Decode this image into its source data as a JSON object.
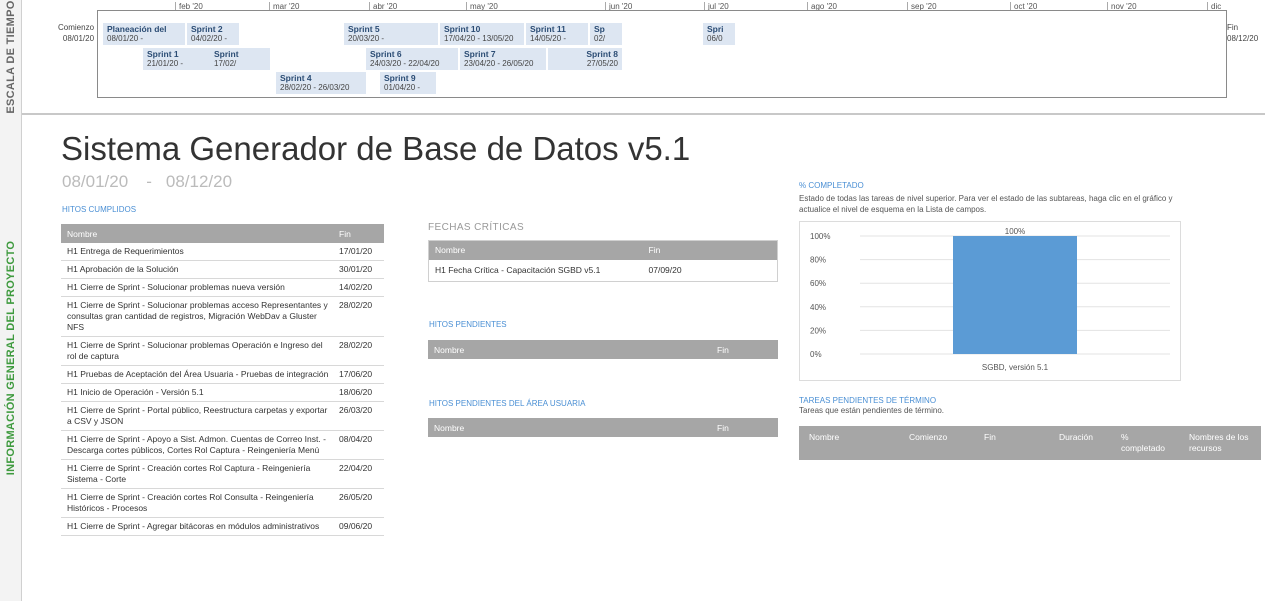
{
  "side": {
    "timeline_label": "ESCALA DE TIEMPO",
    "info_label": "INFORMACIÓN GENERAL DEL PROYECTO"
  },
  "timeline": {
    "start_label": "Comienzo",
    "start_date": "08/01/20",
    "end_label": "Fin",
    "end_date": "08/12/20",
    "months": [
      "feb '20",
      "mar '20",
      "abr '20",
      "may '20",
      "jun '20",
      "jul '20",
      "ago '20",
      "sep '20",
      "oct '20",
      "nov '20",
      "dic '20"
    ],
    "tasks": [
      {
        "name": "Planeación del",
        "dates": "08/01/20 -"
      },
      {
        "name": "Sprint 2",
        "dates": "04/02/20 -"
      },
      {
        "name": "Sprint 1",
        "dates": "21/01/20 -"
      },
      {
        "name": "Sprint",
        "dates": "17/02/"
      },
      {
        "name": "Sprint 4",
        "dates": "28/02/20 - 26/03/20"
      },
      {
        "name": "Sprint 5",
        "dates": "20/03/20 -"
      },
      {
        "name": "Sprint 6",
        "dates": "24/03/20 - 22/04/20"
      },
      {
        "name": "Sprint 9",
        "dates": "01/04/20 -"
      },
      {
        "name": "Sprint 10",
        "dates": "17/04/20 - 13/05/20"
      },
      {
        "name": "Sprint 7",
        "dates": "23/04/20 - 26/05/20"
      },
      {
        "name": "Sprint 11",
        "dates": "14/05/20 -"
      },
      {
        "name": "Sp",
        "dates": "02/"
      },
      {
        "name": "Sprint 8",
        "dates": "27/05/20"
      },
      {
        "name": "Spri",
        "dates": "06/0"
      }
    ]
  },
  "project": {
    "title": "Sistema Generador de Base de Datos v5.1",
    "start": "08/01/20",
    "dash": "-",
    "end": "08/12/20"
  },
  "hitos_cumplidos": {
    "label": "HITOS CUMPLIDOS",
    "col_name": "Nombre",
    "col_fin": "Fin",
    "rows": [
      {
        "name": "H1 Entrega de Requerimientos",
        "fin": "17/01/20"
      },
      {
        "name": "H1 Aprobación de la Solución",
        "fin": "30/01/20"
      },
      {
        "name": "H1 Cierre de Sprint - Solucionar problemas nueva versión",
        "fin": "14/02/20"
      },
      {
        "name": "H1 Cierre de Sprint - Solucionar problemas acceso Representantes y consultas gran cantidad de registros, Migración WebDav a Gluster NFS",
        "fin": "28/02/20"
      },
      {
        "name": "H1 Cierre de Sprint - Solucionar problemas Operación e Ingreso del rol de captura",
        "fin": "28/02/20"
      },
      {
        "name": "H1 Pruebas de Aceptación del Área Usuaria - Pruebas de integración",
        "fin": "17/06/20"
      },
      {
        "name": "H1 Inicio de Operación - Versión 5.1",
        "fin": "18/06/20"
      },
      {
        "name": "H1 Cierre de Sprint - Portal público, Reestructura carpetas y exportar a CSV y JSON",
        "fin": "26/03/20"
      },
      {
        "name": "H1 Cierre de Sprint - Apoyo a Sist. Admon. Cuentas de Correo Inst. - Descarga cortes públicos, Cortes Rol Captura - Reingeniería Menú",
        "fin": "08/04/20"
      },
      {
        "name": "H1 Cierre de Sprint - Creación cortes Rol Captura - Reingeniería Sistema - Corte",
        "fin": "22/04/20"
      },
      {
        "name": "H1 Cierre de Sprint - Creación cortes Rol Consulta - Reingeniería Históricos - Procesos",
        "fin": "26/05/20"
      },
      {
        "name": "H1 Cierre de Sprint - Agregar bitácoras en módulos administrativos",
        "fin": "09/06/20"
      }
    ]
  },
  "fechas_criticas": {
    "label": "FECHAS CRÍTICAS",
    "col_name": "Nombre",
    "col_fin": "Fin",
    "rows": [
      {
        "name": "H1 Fecha Crítica - Capacitación SGBD v5.1",
        "fin": "07/09/20"
      }
    ]
  },
  "hitos_pendientes": {
    "label": "HITOS PENDIENTES",
    "col_name": "Nombre",
    "col_fin": "Fin"
  },
  "hitos_pendientes_usuaria": {
    "label": "HITOS PENDIENTES DEL ÁREA USUARIA",
    "col_name": "Nombre",
    "col_fin": "Fin"
  },
  "completado": {
    "label": "% COMPLETADO",
    "description": "Estado de todas las tareas de nivel superior. Para ver el estado de las subtareas, haga clic en el gráfico y actualice el nivel de esquema en la Lista de campos."
  },
  "chart_data": {
    "type": "bar",
    "categories": [
      "SGBD, versión 5.1"
    ],
    "values": [
      100
    ],
    "data_labels": [
      "100%"
    ],
    "ylim": [
      0,
      100
    ],
    "yticks": [
      "0%",
      "20%",
      "40%",
      "60%",
      "80%",
      "100%"
    ],
    "grid": true,
    "bar_color": "#5b9bd5"
  },
  "tareas_pendientes": {
    "label": "TAREAS PENDIENTES DE TÉRMINO",
    "description": "Tareas que están pendientes de término.",
    "columns": [
      "Nombre",
      "Comienzo",
      "Fin",
      "Duración",
      "% completado",
      "Nombres de los recursos"
    ]
  }
}
